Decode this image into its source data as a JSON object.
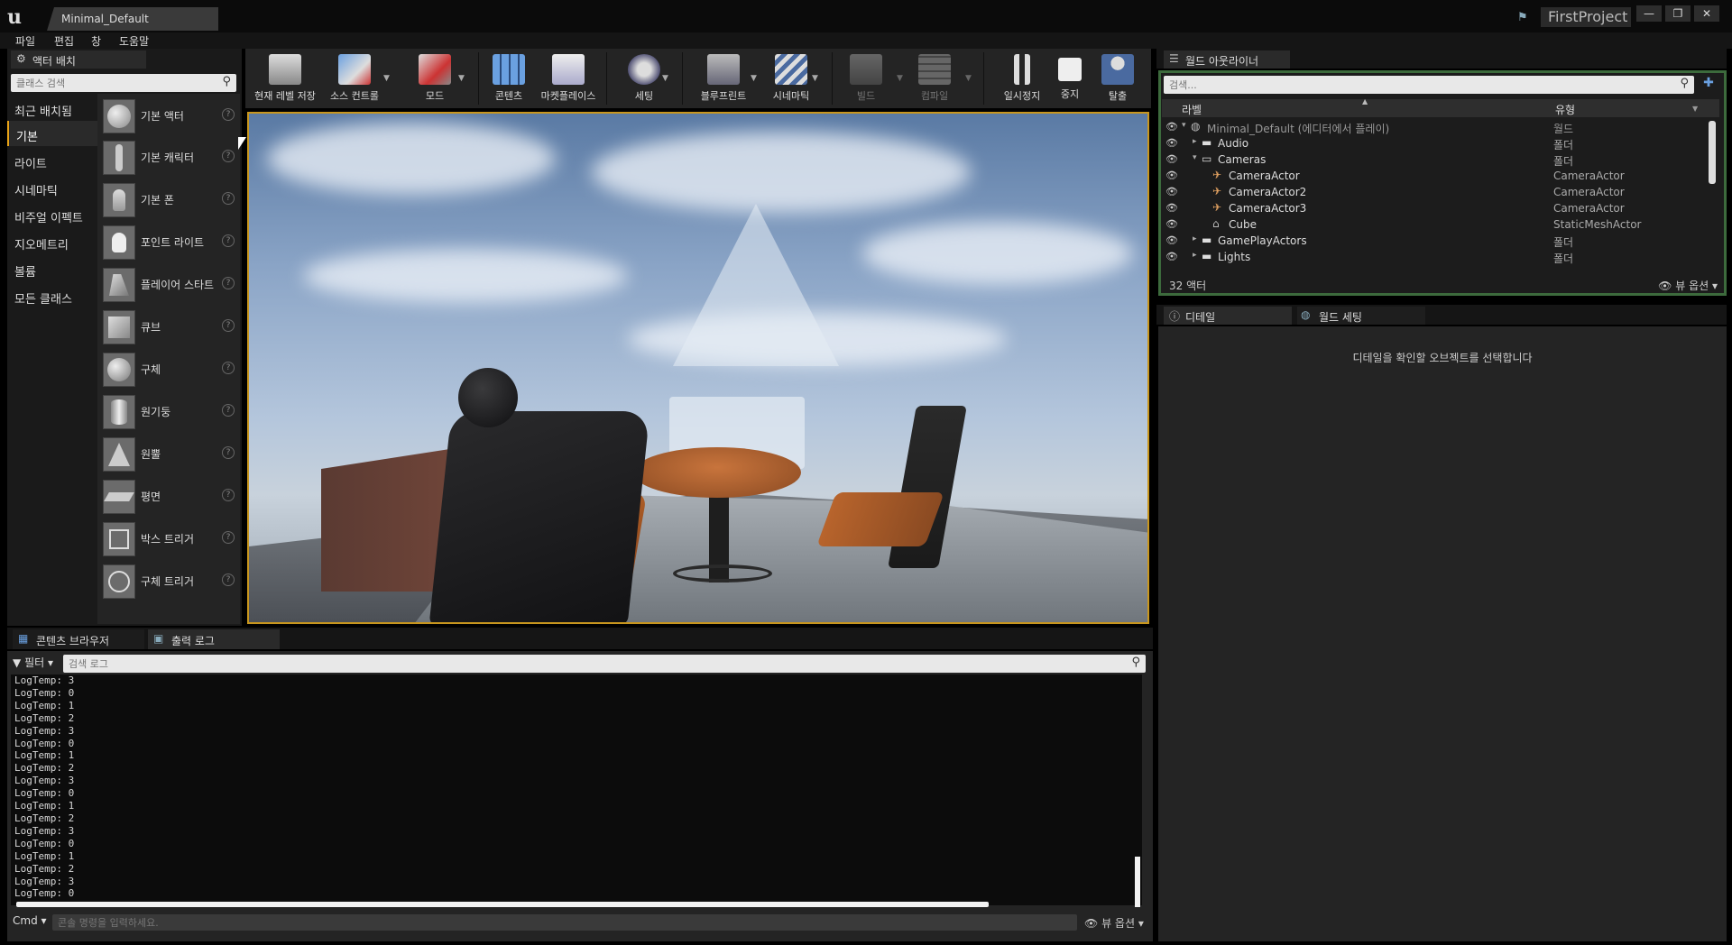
{
  "window": {
    "doc_tab": "Minimal_Default",
    "project": "FirstProject",
    "min_icon": "minimize-icon",
    "max_icon": "maximize-icon",
    "close_icon": "close-icon"
  },
  "menu": [
    "파일",
    "편집",
    "창",
    "도움말"
  ],
  "placement": {
    "tab_label": "액터 배치",
    "search_placeholder": "클래스 검색",
    "categories": [
      "최근 배치됨",
      "기본",
      "라이트",
      "시네마틱",
      "비주얼 이펙트",
      "지오메트리",
      "볼륨",
      "모든 클래스"
    ],
    "active_category": "기본",
    "items": [
      "기본 액터",
      "기본 캐릭터",
      "기본 폰",
      "포인트 라이트",
      "플레이어 스타트",
      "큐브",
      "구체",
      "원기둥",
      "원뿔",
      "평면",
      "박스 트리거",
      "구체 트리거"
    ]
  },
  "toolbar": {
    "save": "현재 레벨 저장",
    "source": "소스 컨트롤",
    "modes": "모드",
    "content": "콘텐츠",
    "marketplace": "마켓플레이스",
    "settings": "세팅",
    "blueprints": "블루프린트",
    "cinematics": "시네마틱",
    "build": "빌드",
    "compile": "컴파일",
    "pause": "일시정지",
    "stop": "중지",
    "eject": "탈출"
  },
  "outliner": {
    "tab_label": "월드 아웃라이너",
    "search_placeholder": "검색...",
    "col_label": "라벨",
    "col_type": "유형",
    "rows": [
      {
        "label": "Minimal_Default (에디터에서 플레이)",
        "type": "월드",
        "indent": 0,
        "icon": "world-icon",
        "expander": "▾",
        "dim": true
      },
      {
        "label": "Audio",
        "type": "폴더",
        "indent": 1,
        "icon": "folder-icon",
        "expander": "▸",
        "dim": false
      },
      {
        "label": "Cameras",
        "type": "폴더",
        "indent": 1,
        "icon": "folder-open-icon",
        "expander": "▾",
        "dim": false
      },
      {
        "label": "CameraActor",
        "type": "CameraActor",
        "indent": 2,
        "icon": "camera-icon",
        "expander": "",
        "dim": false
      },
      {
        "label": "CameraActor2",
        "type": "CameraActor",
        "indent": 2,
        "icon": "camera-icon",
        "expander": "",
        "dim": false
      },
      {
        "label": "CameraActor3",
        "type": "CameraActor",
        "indent": 2,
        "icon": "camera-icon",
        "expander": "",
        "dim": false
      },
      {
        "label": "Cube",
        "type": "StaticMeshActor",
        "indent": 2,
        "icon": "static-mesh-icon",
        "expander": "",
        "dim": false
      },
      {
        "label": "GamePlayActors",
        "type": "폴더",
        "indent": 1,
        "icon": "folder-icon",
        "expander": "▸",
        "dim": false
      },
      {
        "label": "Lights",
        "type": "폴더",
        "indent": 1,
        "icon": "folder-icon",
        "expander": "▸",
        "dim": false
      }
    ],
    "actor_count": "32 액터",
    "view_options": "뷰 옵션"
  },
  "details": {
    "tab_details": "디테일",
    "tab_world": "월드 세팅",
    "message": "디테일을 확인할 오브젝트를 선택합니다"
  },
  "bottom": {
    "tab_content": "콘텐츠 브라우저",
    "tab_output": "출력 로그",
    "filter": "필터",
    "search_placeholder": "검색 로그",
    "log_lines": [
      "LogTemp: 3",
      "LogTemp: 0",
      "LogTemp: 1",
      "LogTemp: 2",
      "LogTemp: 3",
      "LogTemp: 0",
      "LogTemp: 1",
      "LogTemp: 2",
      "LogTemp: 3",
      "LogTemp: 0",
      "LogTemp: 1",
      "LogTemp: 2",
      "LogTemp: 3",
      "LogTemp: 0",
      "LogTemp: 1",
      "LogTemp: 2",
      "LogTemp: 3",
      "LogTemp: 0"
    ],
    "cmd": "Cmd",
    "cmd_placeholder": "콘솔 명령을 입력하세요.",
    "view_options": "뷰 옵션"
  },
  "colors": {
    "accent": "#e8a317",
    "viewport_border": "#c8961e",
    "outliner_border": "#3c6a3c"
  }
}
